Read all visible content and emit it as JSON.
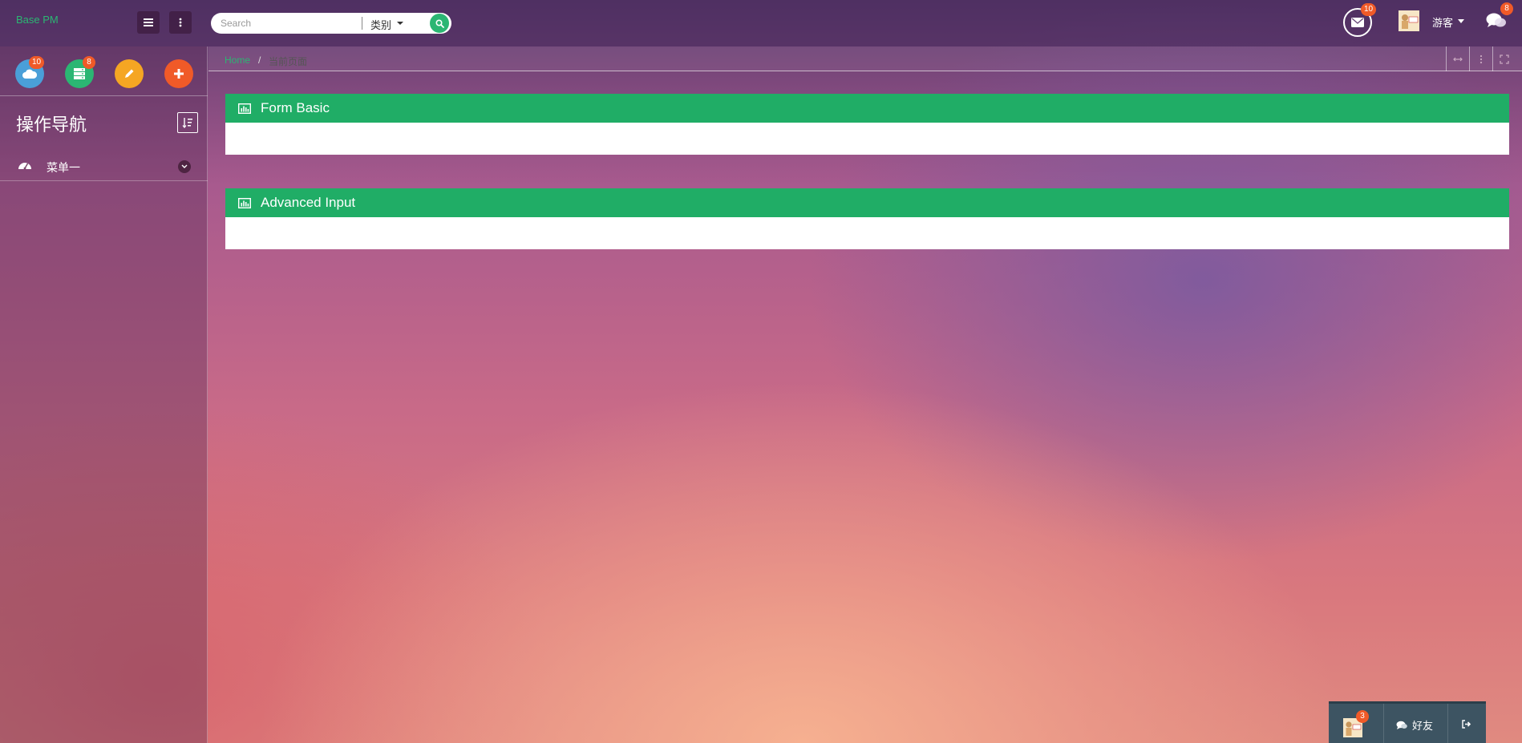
{
  "header": {
    "brand": "Base PM",
    "search_placeholder": "Search",
    "search_category": "类别",
    "mail_badge": "10",
    "user_name": "游客",
    "chat_badge": "8"
  },
  "sidebar": {
    "quick_buttons": [
      {
        "icon": "cloud-icon",
        "color": "#4a9fd8",
        "badge": "10"
      },
      {
        "icon": "server-icon",
        "color": "#2bb673",
        "badge": "8"
      },
      {
        "icon": "pencil-icon",
        "color": "#f5a623",
        "badge": ""
      },
      {
        "icon": "plus-icon",
        "color": "#f05a28",
        "badge": ""
      }
    ],
    "nav_title": "操作导航",
    "menu_items": [
      {
        "label": "菜单一",
        "icon": "dashboard-icon"
      }
    ]
  },
  "breadcrumb": {
    "home": "Home",
    "separator": "/",
    "current": "当前页面"
  },
  "panels": [
    {
      "title": "Form Basic",
      "icon": "bar-chart-icon"
    },
    {
      "title": "Advanced Input",
      "icon": "bar-chart-icon"
    }
  ],
  "chatbar": {
    "badge": "3",
    "friends_label": "好友"
  },
  "colors": {
    "accent_green": "#20ad66",
    "badge_orange": "#f05a28",
    "chatbar_bg": "#3d5462"
  }
}
